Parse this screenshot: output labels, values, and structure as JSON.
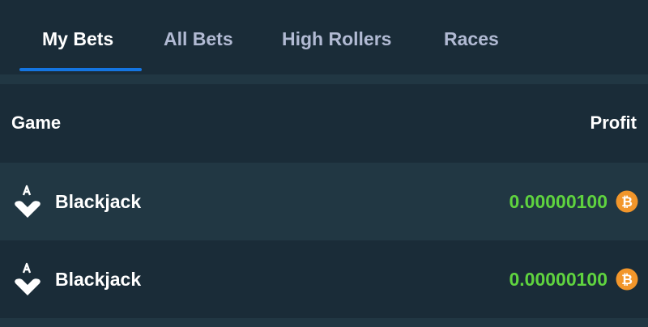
{
  "tabs": [
    {
      "label": "My Bets",
      "active": true
    },
    {
      "label": "All Bets",
      "active": false
    },
    {
      "label": "High Rollers",
      "active": false
    },
    {
      "label": "Races",
      "active": false
    }
  ],
  "table": {
    "columns": {
      "game": "Game",
      "profit": "Profit"
    },
    "rows": [
      {
        "game": "Blackjack",
        "icon": "blackjack-icon",
        "profit": "0.00000100",
        "currency_icon": "bitcoin-icon"
      },
      {
        "game": "Blackjack",
        "icon": "blackjack-icon",
        "profit": "0.00000100",
        "currency_icon": "bitcoin-icon"
      }
    ]
  },
  "colors": {
    "profit_positive": "#5fd33f",
    "bitcoin": "#f2962b",
    "tab_accent": "#1475e1"
  }
}
